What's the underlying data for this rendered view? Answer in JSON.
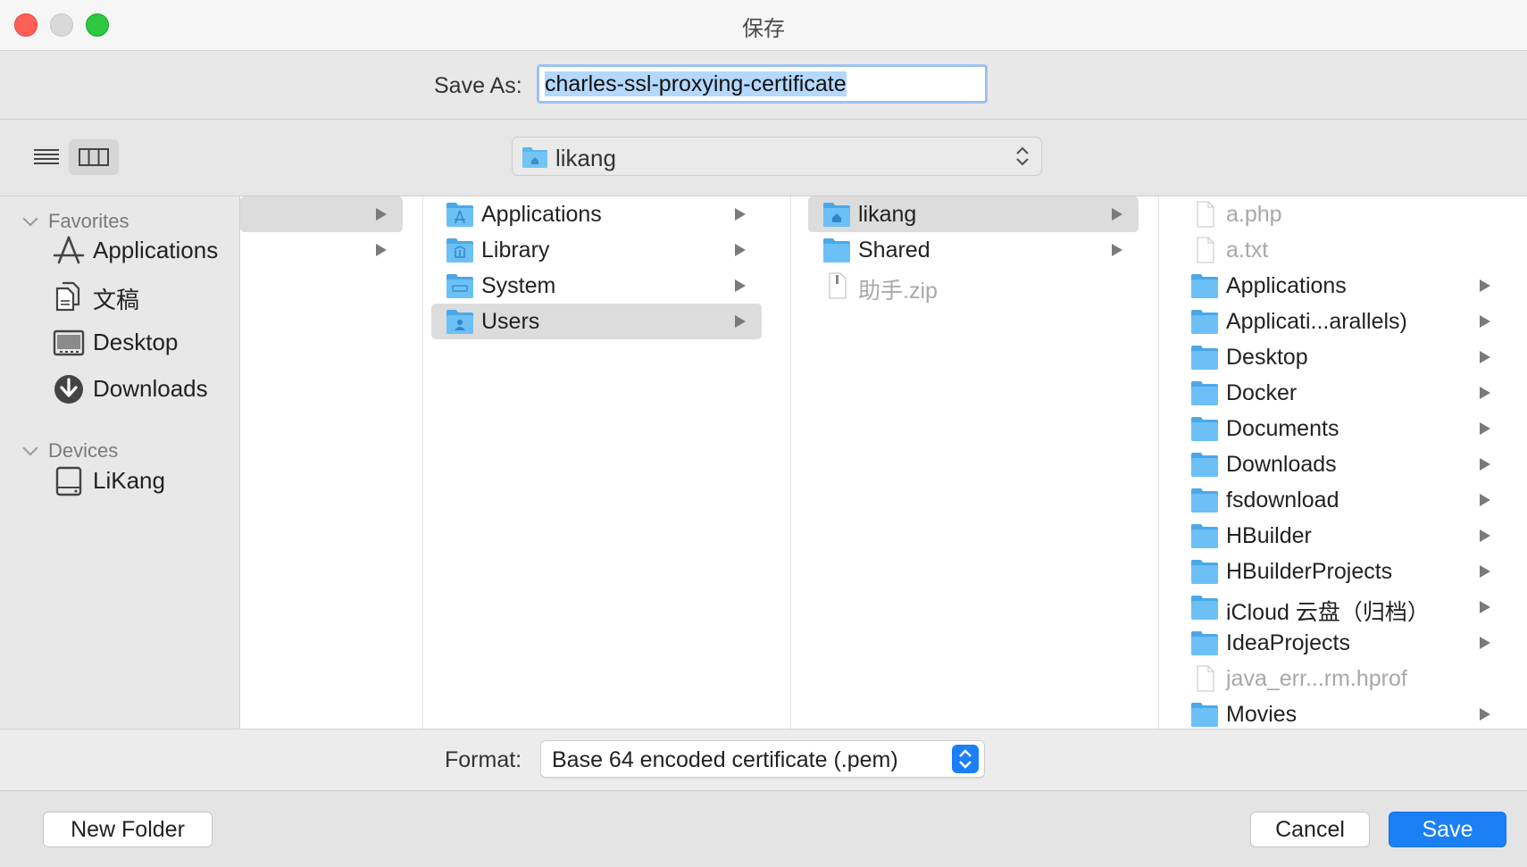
{
  "window": {
    "title": "保存"
  },
  "save_as": {
    "label": "Save As:",
    "value": "charles-ssl-proxying-certificate"
  },
  "toolbar": {
    "view_list_icon": "list-view-icon",
    "view_column_icon": "column-view-icon",
    "path_popup": "likang"
  },
  "sidebar": {
    "favorites_header": "Favorites",
    "favorites": [
      {
        "label": "Applications",
        "icon": "applications-icon"
      },
      {
        "label": "文稿",
        "icon": "documents-icon"
      },
      {
        "label": "Desktop",
        "icon": "desktop-icon"
      },
      {
        "label": "Downloads",
        "icon": "downloads-icon"
      }
    ],
    "devices_header": "Devices",
    "devices": [
      {
        "label": "LiKang",
        "icon": "disk-icon"
      }
    ]
  },
  "columns": {
    "col1": [
      {
        "name": "",
        "selected": true
      },
      {
        "name": ""
      }
    ],
    "col2": [
      {
        "name": "Applications",
        "icon": "folder-applications-icon"
      },
      {
        "name": "Library",
        "icon": "folder-library-icon"
      },
      {
        "name": "System",
        "icon": "folder-system-icon"
      },
      {
        "name": "Users",
        "icon": "folder-users-icon",
        "selected": true
      }
    ],
    "col3": [
      {
        "name": "likang",
        "icon": "folder-home-icon",
        "selected": true
      },
      {
        "name": "Shared",
        "icon": "folder-icon"
      },
      {
        "name": "助手.zip",
        "icon": "zip-file-icon",
        "dim": true
      }
    ],
    "col4": [
      {
        "name": "a.php",
        "icon": "file-icon",
        "dim": true
      },
      {
        "name": "a.txt",
        "icon": "text-file-icon",
        "dim": true
      },
      {
        "name": "Applications",
        "icon": "folder-applications-icon"
      },
      {
        "name": "Applicati...arallels)",
        "icon": "folder-parallels-icon"
      },
      {
        "name": "Desktop",
        "icon": "folder-desktop-icon"
      },
      {
        "name": "Docker",
        "icon": "folder-icon"
      },
      {
        "name": "Documents",
        "icon": "folder-documents-icon"
      },
      {
        "name": "Downloads",
        "icon": "folder-downloads-icon"
      },
      {
        "name": "fsdownload",
        "icon": "folder-icon"
      },
      {
        "name": "HBuilder",
        "icon": "folder-icon"
      },
      {
        "name": "HBuilderProjects",
        "icon": "folder-icon"
      },
      {
        "name": "iCloud 云盘（归档）",
        "icon": "folder-icon"
      },
      {
        "name": "IdeaProjects",
        "icon": "folder-icon"
      },
      {
        "name": "java_err...rm.hprof",
        "icon": "file-icon",
        "dim": true
      },
      {
        "name": "Movies",
        "icon": "folder-movies-icon"
      }
    ]
  },
  "format": {
    "label": "Format:",
    "value": "Base 64 encoded certificate (.pem)"
  },
  "buttons": {
    "new_folder": "New Folder",
    "cancel": "Cancel",
    "save": "Save"
  },
  "colors": {
    "accent": "#1b80f6",
    "folder": "#5ab6f0",
    "selection": "#dcdcdc"
  }
}
